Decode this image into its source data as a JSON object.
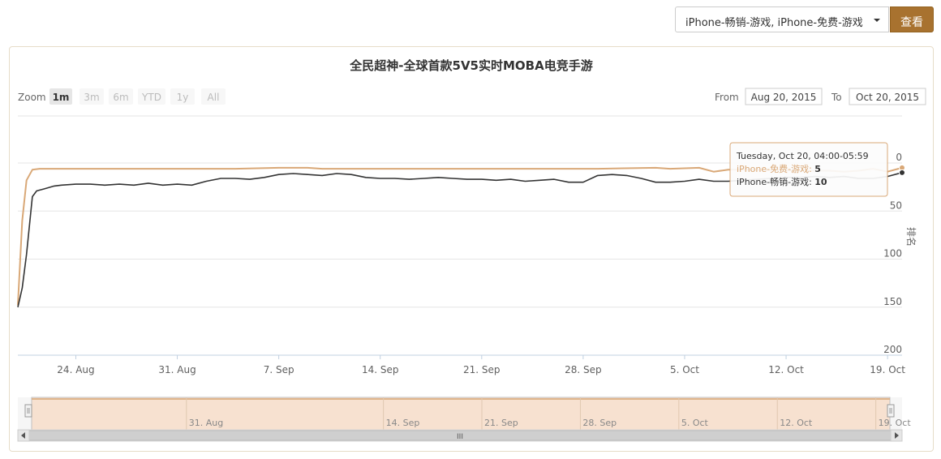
{
  "filter": {
    "selected": "iPhone-畅销-游戏, iPhone-免费-游戏",
    "query_label": "查看"
  },
  "range_selector": {
    "zoom_label": "Zoom",
    "buttons": [
      "1m",
      "3m",
      "6m",
      "YTD",
      "1y",
      "All"
    ],
    "active": "1m",
    "from_label": "From",
    "from_value": "Aug 20, 2015",
    "to_label": "To",
    "to_value": "Oct 20, 2015"
  },
  "tooltip": {
    "header": "Tuesday, Oct 20, 04:00-05:59",
    "rows": [
      {
        "label": "iPhone-免费-游戏:",
        "value": "5"
      },
      {
        "label": "iPhone-畅销-游戏:",
        "value": "10"
      }
    ]
  },
  "navigator": {
    "x_ticks": [
      {
        "label": "31. Aug",
        "day": 11
      },
      {
        "label": "14. Sep",
        "day": 25
      },
      {
        "label": "21. Sep",
        "day": 32
      },
      {
        "label": "28. Sep",
        "day": 39
      },
      {
        "label": "5. Oct",
        "day": 46
      },
      {
        "label": "12. Oct",
        "day": 53
      },
      {
        "label": "19. Oct",
        "day": 60
      }
    ],
    "grip": "III"
  },
  "colors": {
    "free_series": "#d9a877",
    "grossing_series": "#333333",
    "accent": "#a8722f",
    "navigator_fill": "#f7e1d0"
  },
  "chart_data": {
    "type": "line",
    "title": "全民超神-全球首款5V5实时MOBA电竞手游",
    "ylabel": "排名",
    "y_reversed": true,
    "ylim": [
      0,
      200
    ],
    "y_ticks": [
      0,
      50,
      100,
      150,
      200
    ],
    "x_range": [
      "2015-08-20",
      "2015-10-20"
    ],
    "x_ticks": [
      {
        "label": "24. Aug",
        "day": 4
      },
      {
        "label": "31. Aug",
        "day": 11
      },
      {
        "label": "7. Sep",
        "day": 18
      },
      {
        "label": "14. Sep",
        "day": 25
      },
      {
        "label": "21. Sep",
        "day": 32
      },
      {
        "label": "28. Sep",
        "day": 39
      },
      {
        "label": "5. Oct",
        "day": 46
      },
      {
        "label": "12. Oct",
        "day": 53
      },
      {
        "label": "19. Oct",
        "day": 60
      }
    ],
    "series": [
      {
        "name": "iPhone-免费-游戏",
        "points": [
          [
            0.0,
            148
          ],
          [
            0.3,
            60
          ],
          [
            0.6,
            18
          ],
          [
            1.0,
            7
          ],
          [
            1.5,
            6
          ],
          [
            2,
            6
          ],
          [
            5,
            6
          ],
          [
            8,
            6
          ],
          [
            10,
            6
          ],
          [
            15,
            6
          ],
          [
            18,
            5
          ],
          [
            20,
            5
          ],
          [
            21,
            6
          ],
          [
            25,
            6
          ],
          [
            30,
            6
          ],
          [
            35,
            6
          ],
          [
            40,
            6
          ],
          [
            44,
            5
          ],
          [
            45,
            6
          ],
          [
            47,
            5
          ],
          [
            48,
            9
          ],
          [
            49,
            7
          ],
          [
            50,
            7
          ],
          [
            54,
            8
          ],
          [
            55,
            8
          ],
          [
            56,
            8
          ],
          [
            57,
            9
          ],
          [
            58,
            8
          ],
          [
            59,
            6
          ],
          [
            60,
            9
          ],
          [
            61,
            5
          ]
        ]
      },
      {
        "name": "iPhone-畅销-游戏",
        "points": [
          [
            0.0,
            150
          ],
          [
            0.3,
            130
          ],
          [
            0.6,
            95
          ],
          [
            0.8,
            65
          ],
          [
            1.0,
            35
          ],
          [
            1.3,
            29
          ],
          [
            1.8,
            27
          ],
          [
            2.5,
            24
          ],
          [
            3,
            23
          ],
          [
            4,
            22
          ],
          [
            5,
            22
          ],
          [
            6,
            23
          ],
          [
            7,
            22
          ],
          [
            8,
            23
          ],
          [
            9,
            21
          ],
          [
            10,
            23
          ],
          [
            11,
            22
          ],
          [
            12,
            23
          ],
          [
            13,
            19
          ],
          [
            14,
            16
          ],
          [
            15,
            16
          ],
          [
            16,
            17
          ],
          [
            17,
            15
          ],
          [
            18,
            12
          ],
          [
            19,
            11
          ],
          [
            20,
            12
          ],
          [
            21,
            13
          ],
          [
            22,
            11
          ],
          [
            23,
            12
          ],
          [
            24,
            15
          ],
          [
            25,
            16
          ],
          [
            26,
            16
          ],
          [
            27,
            17
          ],
          [
            28,
            16
          ],
          [
            29,
            15
          ],
          [
            30,
            16
          ],
          [
            31,
            17
          ],
          [
            32,
            17
          ],
          [
            33,
            18
          ],
          [
            34,
            17
          ],
          [
            35,
            19
          ],
          [
            36,
            18
          ],
          [
            37,
            17
          ],
          [
            38,
            20
          ],
          [
            39,
            20
          ],
          [
            40,
            13
          ],
          [
            41,
            12
          ],
          [
            42,
            13
          ],
          [
            43,
            16
          ],
          [
            44,
            20
          ],
          [
            45,
            20
          ],
          [
            46,
            19
          ],
          [
            47,
            17
          ],
          [
            48,
            19
          ],
          [
            49,
            19
          ],
          [
            50,
            18
          ],
          [
            51,
            17
          ],
          [
            52,
            16
          ],
          [
            53,
            15
          ],
          [
            54,
            15
          ],
          [
            55,
            14
          ],
          [
            56,
            15
          ],
          [
            57,
            14
          ],
          [
            58,
            16
          ],
          [
            59,
            16
          ],
          [
            60,
            14
          ],
          [
            61,
            10
          ]
        ]
      }
    ]
  }
}
